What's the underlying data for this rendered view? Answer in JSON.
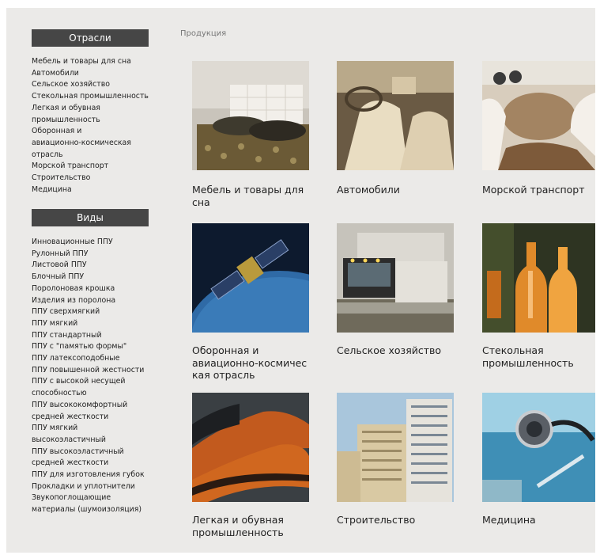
{
  "sidebar": {
    "industries_heading": "Отрасли",
    "industries": [
      "Мебель и товары для сна",
      "Автомобили",
      "Сельское хозяйство",
      "Стекольная промышленность",
      "Легкая и обувная",
      "промышленность",
      "Оборонная и",
      "авиационно-космическая",
      "отрасль",
      "Морской транспорт",
      "Строительство",
      "Медицина"
    ],
    "types_heading": "Виды",
    "types": [
      "Инновационные ППУ",
      "Рулонный ППУ",
      "Листовой ППУ",
      "Блочный ППУ",
      "Поролоновая крошка",
      "Изделия из поролона",
      "ППУ сверхмягкий",
      "ППУ мягкий",
      "ППУ стандартный",
      "ППУ с \"памятью формы\"",
      "ППУ латексоподобные",
      "ППУ повышенной жестности",
      "ППУ с высокой несущей",
      "способностью",
      "ППУ высококомфортный",
      "средней жесткости",
      "ППУ мягкий",
      "высокоэластичный",
      "ППУ высокоэластичный",
      "средней жесткости",
      "ППУ для изготовления губок",
      "Прокладки и уплотнители",
      "Звукопоглощающие",
      "материалы (шумоизоляция)"
    ]
  },
  "breadcrumb": "Продукция",
  "grid": [
    {
      "lines": [
        "Мебель и товары для",
        "сна"
      ],
      "image": "bed"
    },
    {
      "lines": [
        "Автомобили"
      ],
      "image": "car-interior"
    },
    {
      "lines": [
        "Морской транспорт"
      ],
      "image": "boat-deck"
    },
    {
      "lines": [
        "Оборонная и",
        "авиационно-космичес",
        "кая отрасль"
      ],
      "image": "satellite"
    },
    {
      "lines": [
        "Сельское хозяйство"
      ],
      "image": "harvester"
    },
    {
      "lines": [
        "Стекольная",
        "промышленность"
      ],
      "image": "glass-bottles"
    },
    {
      "lines": [
        "Легкая и обувная",
        "промышленность"
      ],
      "image": "shoes"
    },
    {
      "lines": [
        "Строительство"
      ],
      "image": "building"
    },
    {
      "lines": [
        "Медицина"
      ],
      "image": "stethoscope"
    }
  ]
}
